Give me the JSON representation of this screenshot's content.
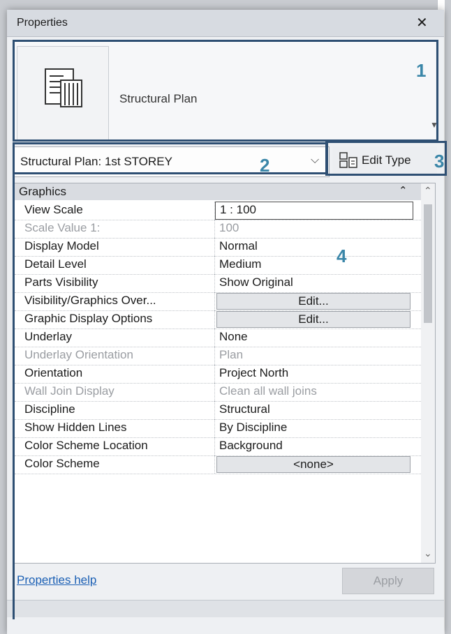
{
  "panel": {
    "title": "Properties"
  },
  "type_selector": {
    "type_name": "Structural Plan"
  },
  "view_selector": {
    "value": "Structural Plan: 1st STOREY"
  },
  "edit_type": {
    "label": "Edit Type"
  },
  "grid": {
    "group": "Graphics",
    "rows": [
      {
        "label": "View Scale",
        "value": "1 : 100",
        "kind": "input",
        "enabled": true
      },
      {
        "label": "Scale Value    1:",
        "value": "100",
        "kind": "text",
        "enabled": false
      },
      {
        "label": "Display Model",
        "value": "Normal",
        "kind": "text",
        "enabled": true
      },
      {
        "label": "Detail Level",
        "value": "Medium",
        "kind": "text",
        "enabled": true
      },
      {
        "label": "Parts Visibility",
        "value": "Show Original",
        "kind": "text",
        "enabled": true
      },
      {
        "label": "Visibility/Graphics Over...",
        "value": "Edit...",
        "kind": "button",
        "enabled": true
      },
      {
        "label": "Graphic Display Options",
        "value": "Edit...",
        "kind": "button",
        "enabled": true
      },
      {
        "label": "Underlay",
        "value": "None",
        "kind": "text",
        "enabled": true
      },
      {
        "label": "Underlay Orientation",
        "value": "Plan",
        "kind": "text",
        "enabled": false
      },
      {
        "label": "Orientation",
        "value": "Project North",
        "kind": "text",
        "enabled": true
      },
      {
        "label": "Wall Join Display",
        "value": "Clean all wall joins",
        "kind": "text",
        "enabled": false
      },
      {
        "label": "Discipline",
        "value": "Structural",
        "kind": "text",
        "enabled": true
      },
      {
        "label": "Show Hidden Lines",
        "value": "By Discipline",
        "kind": "text",
        "enabled": true
      },
      {
        "label": "Color Scheme Location",
        "value": "Background",
        "kind": "text",
        "enabled": true
      },
      {
        "label": "Color Scheme",
        "value": "<none>",
        "kind": "button",
        "enabled": true
      }
    ]
  },
  "footer": {
    "help_link": "Properties help",
    "apply_label": "Apply"
  },
  "callouts": [
    {
      "number": "1"
    },
    {
      "number": "2"
    },
    {
      "number": "3"
    },
    {
      "number": "4"
    }
  ],
  "colors": {
    "callout_border": "#2e4f73",
    "callout_number": "#3a86a8",
    "link": "#1a5fb4"
  },
  "icons": [
    "close-icon",
    "structural-plan-type-icon",
    "dropdown-arrow-icon",
    "chevron-down-icon",
    "edit-type-icon",
    "collapse-group-icon",
    "scroll-up-icon",
    "scroll-down-icon"
  ]
}
